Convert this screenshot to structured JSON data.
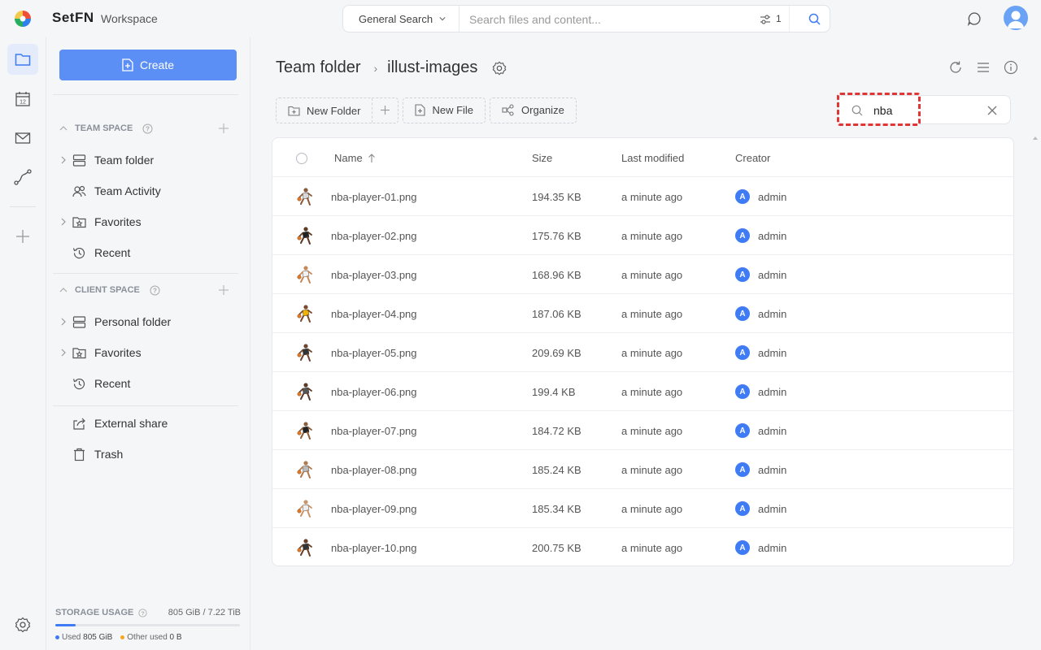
{
  "brand": {
    "name": "SetFN",
    "workspace": "Workspace"
  },
  "search": {
    "scope": "General Search",
    "placeholder": "Search files and content...",
    "filter_count": "1"
  },
  "sidebar": {
    "create_label": "Create",
    "team_space": {
      "title": "TEAM SPACE",
      "items": [
        {
          "label": "Team folder",
          "icon": "server-icon",
          "expandable": true
        },
        {
          "label": "Team Activity",
          "icon": "users-icon",
          "expandable": false
        },
        {
          "label": "Favorites",
          "icon": "star-folder-icon",
          "expandable": true
        },
        {
          "label": "Recent",
          "icon": "history-icon",
          "expandable": false
        }
      ]
    },
    "client_space": {
      "title": "CLIENT SPACE",
      "items": [
        {
          "label": "Personal folder",
          "icon": "server-icon",
          "expandable": true
        },
        {
          "label": "Favorites",
          "icon": "star-folder-icon",
          "expandable": true
        },
        {
          "label": "Recent",
          "icon": "history-icon",
          "expandable": false
        }
      ]
    },
    "other": [
      {
        "label": "External share",
        "icon": "share-icon"
      },
      {
        "label": "Trash",
        "icon": "trash-icon"
      }
    ],
    "storage": {
      "label": "STORAGE USAGE",
      "value": "805 GiB / 7.22 TiB",
      "used_fraction": 0.109,
      "used_label": "Used",
      "used_value": "805 GiB",
      "other_label": "Other used",
      "other_value": "0 B",
      "used_color": "#3f7bf5",
      "other_color": "#f5a623"
    }
  },
  "main": {
    "breadcrumb": [
      "Team folder",
      "illust-images"
    ],
    "toolbar": {
      "new_folder": "New Folder",
      "new_file": "New File",
      "organize": "Organize"
    },
    "filter_value": "nba",
    "table": {
      "columns": {
        "name": "Name",
        "size": "Size",
        "modified": "Last modified",
        "creator": "Creator"
      },
      "rows": [
        {
          "name": "nba-player-01.png",
          "size": "194.35 KB",
          "modified": "a minute ago",
          "creator": "admin",
          "initial": "A"
        },
        {
          "name": "nba-player-02.png",
          "size": "175.76 KB",
          "modified": "a minute ago",
          "creator": "admin",
          "initial": "A"
        },
        {
          "name": "nba-player-03.png",
          "size": "168.96 KB",
          "modified": "a minute ago",
          "creator": "admin",
          "initial": "A"
        },
        {
          "name": "nba-player-04.png",
          "size": "187.06 KB",
          "modified": "a minute ago",
          "creator": "admin",
          "initial": "A"
        },
        {
          "name": "nba-player-05.png",
          "size": "209.69 KB",
          "modified": "a minute ago",
          "creator": "admin",
          "initial": "A"
        },
        {
          "name": "nba-player-06.png",
          "size": "199.4 KB",
          "modified": "a minute ago",
          "creator": "admin",
          "initial": "A"
        },
        {
          "name": "nba-player-07.png",
          "size": "184.72 KB",
          "modified": "a minute ago",
          "creator": "admin",
          "initial": "A"
        },
        {
          "name": "nba-player-08.png",
          "size": "185.24 KB",
          "modified": "a minute ago",
          "creator": "admin",
          "initial": "A"
        },
        {
          "name": "nba-player-09.png",
          "size": "185.34 KB",
          "modified": "a minute ago",
          "creator": "admin",
          "initial": "A"
        },
        {
          "name": "nba-player-10.png",
          "size": "200.75 KB",
          "modified": "a minute ago",
          "creator": "admin",
          "initial": "A"
        }
      ]
    }
  },
  "colors": {
    "accent": "#5b8ff5",
    "highlight": "#e03535",
    "avatar": "#3f7bf5"
  }
}
